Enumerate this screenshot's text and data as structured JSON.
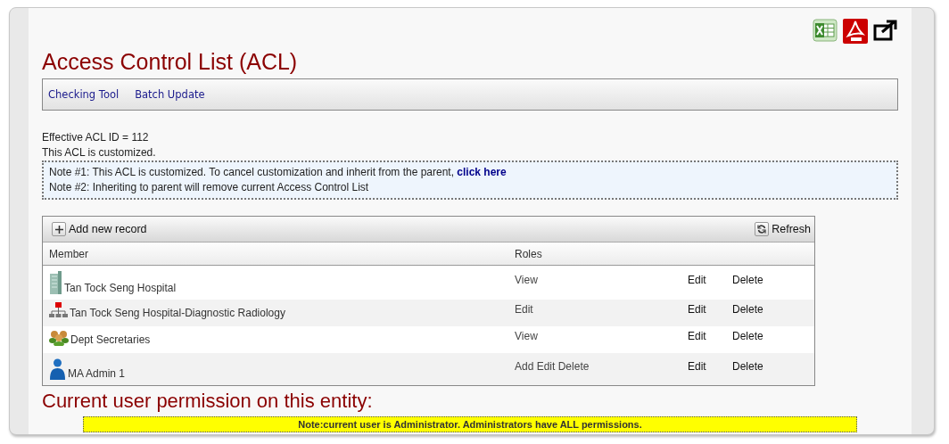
{
  "title": "Access Control List (ACL)",
  "toolbar": [
    "Checking Tool",
    "Batch Update"
  ],
  "info": [
    "Effective ACL ID = 112",
    "This ACL is customized."
  ],
  "notes": [
    "Note #1: This ACL is customized. To cancel customization and inherit from the parent, **click here**",
    "Note #2: Inheriting to parent will remove current Access Control List"
  ],
  "grid": {
    "add_label": "Add new record",
    "refresh_label": "Refresh",
    "columns": [
      "Member",
      "Roles"
    ],
    "rows": [
      {
        "kind": "building",
        "member": "Tan Tock Seng Hospital",
        "roles": "View",
        "edit": "Edit",
        "delete": "Delete"
      },
      {
        "kind": "org",
        "member": "Tan Tock Seng Hospital-Diagnostic Radiology",
        "roles": "Edit",
        "edit": "Edit",
        "delete": "Delete"
      },
      {
        "kind": "group",
        "member": "Dept Secretaries",
        "roles": "View",
        "edit": "Edit",
        "delete": "Delete"
      },
      {
        "kind": "user",
        "member": "MA Admin 1",
        "roles": "Add Edit Delete",
        "edit": "Edit",
        "delete": "Delete"
      }
    ]
  },
  "permission_heading": "Current user permission on this entity:",
  "permission_note": "Note:current user is Administrator. Administrators have ALL permissions."
}
